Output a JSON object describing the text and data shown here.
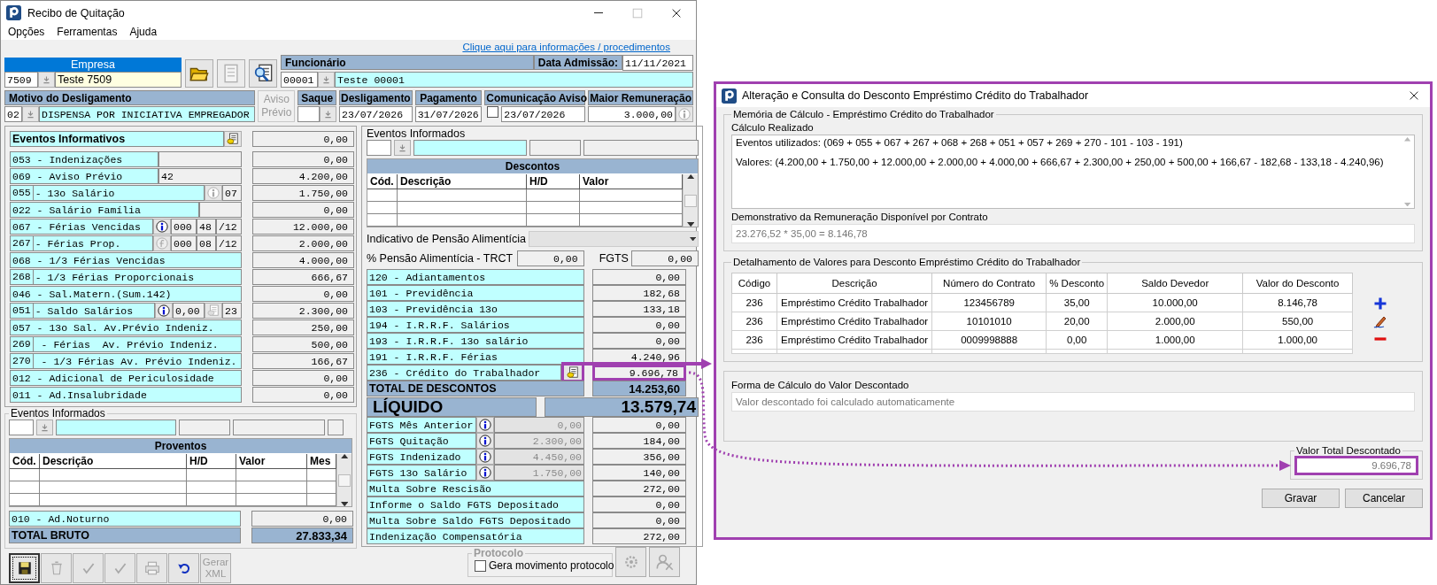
{
  "window": {
    "title": "Recibo de Quitação",
    "menu": [
      "Opções",
      "Ferramentas",
      "Ajuda"
    ],
    "help_link": "Clique aqui para informações / procedimentos"
  },
  "empresa": {
    "label": "Empresa",
    "code": "7509",
    "name": "Teste 7509"
  },
  "empresa_tools": [
    {
      "kind": "folder",
      "enabled": true
    },
    {
      "kind": "document",
      "enabled": false
    },
    {
      "kind": "search",
      "enabled": true
    }
  ],
  "funcionario": {
    "label": "Funcionário",
    "code": "00001",
    "name": "Teste 00001",
    "admission_label": "Data Admissão:",
    "admission_date": "11/11/2021"
  },
  "motivo": {
    "label": "Motivo do Desligamento",
    "code": "02",
    "description": "DISPENSA POR INICIATIVA EMPREGADOR"
  },
  "aviso_previo": {
    "label": "Aviso Prévio",
    "enabled": false
  },
  "dates": [
    {
      "kind": "dropdown",
      "label": "Saque"
    },
    {
      "kind": "date",
      "label": "Desligamento",
      "value": "23/07/2026"
    },
    {
      "kind": "date",
      "label": "Pagamento",
      "value": "31/07/2026"
    },
    {
      "kind": "checkdate",
      "label": "Comunicação Aviso",
      "checked": false,
      "value": "23/07/2026"
    },
    {
      "kind": "amount",
      "label": "Maior Remuneração",
      "value": "3.000,00"
    }
  ],
  "eventos_informativos": {
    "label": "Eventos Informativos",
    "value": "0,00"
  },
  "proventos_items": [
    {
      "kind": "wide_field",
      "split": false,
      "label": "053 - Indenizações",
      "value": "0,00"
    },
    {
      "kind": "wide_field",
      "split": false,
      "label": "069 - Aviso Prévio",
      "note": "42",
      "value": "4.200,00"
    },
    {
      "kind": "icon_fields",
      "split": true,
      "code": "055",
      "label": "- 13o Salário",
      "fields": [
        {
          "kind": "info",
          "enabled": false
        },
        {
          "kind": "text",
          "text": "07"
        }
      ],
      "value": "1.750,00"
    },
    {
      "kind": "narrow_field",
      "split": false,
      "label": "022 - Salário Família",
      "value": "0,00"
    },
    {
      "kind": "icon_fields",
      "split": false,
      "label": "067 - Férias Vencidas",
      "fields": [
        {
          "kind": "info",
          "enabled": true
        },
        {
          "kind": "text",
          "text": "000"
        },
        {
          "kind": "text",
          "text": "48"
        },
        {
          "kind": "text",
          "text": "/12"
        }
      ],
      "value": "12.000,00"
    },
    {
      "kind": "icon_fields",
      "split": true,
      "code": "267",
      "label": "- Férias Prop.",
      "fields": [
        {
          "kind": "formula",
          "enabled": false
        },
        {
          "kind": "text",
          "text": "000"
        },
        {
          "kind": "text",
          "text": "08"
        },
        {
          "kind": "text",
          "text": "/12"
        }
      ],
      "value": "2.000,00"
    },
    {
      "kind": "full",
      "split": false,
      "label": "068 - 1/3 Férias Vencidas",
      "value": "4.000,00"
    },
    {
      "kind": "full",
      "split": true,
      "code": "268",
      "label": "- 1/3 Férias Proporcionais",
      "value": "666,67"
    },
    {
      "kind": "full",
      "split": false,
      "label": "046 - Sal.Matern.(Sum.142)",
      "value": "0,00"
    },
    {
      "kind": "icon_fields",
      "split": true,
      "code": "051",
      "label": "- Saldo Salários",
      "fields": [
        {
          "kind": "info",
          "enabled": true
        },
        {
          "kind": "text",
          "text": "0,00"
        },
        {
          "kind": "doc",
          "enabled": false
        },
        {
          "kind": "text",
          "text": "23"
        }
      ],
      "value": "2.300,00"
    },
    {
      "kind": "full",
      "split": false,
      "label": "057 - 13o Sal. Av.Prévio Indeniz.",
      "value": "250,00"
    },
    {
      "kind": "full",
      "split": true,
      "code": "269",
      "label": " - Férias  Av. Prévio Indeniz.",
      "value": "500,00"
    },
    {
      "kind": "full",
      "split": true,
      "code": "270",
      "label": " - 1/3 Férias Av. Prévio Indeniz.",
      "value": "166,67"
    },
    {
      "kind": "full",
      "split": false,
      "label": "012 - Adicional de Periculosidade",
      "value": "0,00"
    },
    {
      "kind": "full",
      "split": false,
      "label": "011 - Ad.Insalubridade",
      "value": "0,00"
    }
  ],
  "eventos_informados_left": {
    "label": "Eventos Informados"
  },
  "proventos_table": {
    "title": "Proventos",
    "columns": [
      "Cód.",
      "Descrição",
      "H/D",
      "Valor",
      "Mes"
    ]
  },
  "ad_noturno": {
    "label": "010 - Ad.Noturno",
    "value": "0,00"
  },
  "total_bruto": {
    "label": "TOTAL BRUTO",
    "value": "27.833,34"
  },
  "toolbar": [
    {
      "kind": "save",
      "enabled": true
    },
    {
      "kind": "delete",
      "enabled": false
    },
    {
      "kind": "check",
      "enabled": false
    },
    {
      "kind": "check",
      "enabled": false
    },
    {
      "kind": "print",
      "enabled": false
    },
    {
      "kind": "undo",
      "enabled": true
    },
    {
      "kind": "text",
      "label": "Gerar XML",
      "enabled": false
    }
  ],
  "eventos_informados_right": {
    "label": "Eventos Informados"
  },
  "descontos_table": {
    "title": "Descontos",
    "columns": [
      "Cód.",
      "Descrição",
      "H/D",
      "Valor"
    ]
  },
  "pensao": {
    "indicativo_label": "Indicativo de Pensão Alimentícia",
    "percent_label": "% Pensão Alimentícia - TRCT",
    "percent_value": "0,00",
    "fgts_label": "FGTS",
    "fgts_value": "0,00"
  },
  "descontos_items": [
    {
      "label": "120 - Adiantamentos",
      "value": "0,00",
      "action": false,
      "highlighted": false
    },
    {
      "label": "101 - Previdência",
      "value": "182,68",
      "action": false,
      "highlighted": false
    },
    {
      "label": "103 - Previdência 13o",
      "value": "133,18",
      "action": false,
      "highlighted": false
    },
    {
      "label": "194 - I.R.R.F. Salários",
      "value": "0,00",
      "action": false,
      "highlighted": false
    },
    {
      "label": "193 - I.R.R.F. 13o salário",
      "value": "0,00",
      "action": false,
      "highlighted": false
    },
    {
      "label": "191 - I.R.R.F. Férias",
      "value": "4.240,96",
      "action": false,
      "highlighted": false
    },
    {
      "label": "236 - Crédito do Trabalhador",
      "value": "9.696,78",
      "action": true,
      "highlighted": true
    }
  ],
  "total_descontos": {
    "label": "TOTAL DE DESCONTOS",
    "value": "14.253,60"
  },
  "liquido": {
    "label": "LÍQUIDO",
    "value": "13.579,74"
  },
  "fgts_items": [
    {
      "label": "FGTS Mês Anterior",
      "base": "0,00",
      "value": "0,00"
    },
    {
      "label": "FGTS Quitação",
      "base": "2.300,00",
      "value": "184,00"
    },
    {
      "label": "FGTS Indenizado",
      "base": "4.450,00",
      "value": "356,00"
    },
    {
      "label": "FGTS 13o Salário",
      "base": "1.750,00",
      "value": "140,00"
    }
  ],
  "other_items": [
    {
      "label": "Multa Sobre Rescisão",
      "value": "272,00"
    },
    {
      "label": "Informe o Saldo FGTS Depositado",
      "value": "0,00"
    },
    {
      "label": "Multa Sobre Saldo FGTS Depositado",
      "value": "0,00"
    },
    {
      "label": "Indenização Compensatória",
      "value": "272,00"
    }
  ],
  "protocolo": {
    "legend": "Protocolo",
    "checkbox_label": "Gera movimento protocolo",
    "checked": false
  },
  "dialog": {
    "title": "Alteração e Consulta do Desconto Empréstimo Crédito do Trabalhador",
    "highlighted": true,
    "memoria": {
      "legend": "Memória de Cálculo - Empréstimo Crédito do Trabalhador",
      "calc_label": "Cálculo Realizado",
      "calc_lines": [
        "Eventos utilizados: (069 + 055 + 067 + 267 + 068 + 268 + 051 + 057 + 269 + 270 - 101 - 103 - 191)",
        "Valores: (4.200,00 + 1.750,00 + 12.000,00 + 2.000,00 + 4.000,00 + 666,67 + 2.300,00 + 250,00 + 500,00 + 166,67 - 182,68 - 133,18 - 4.240,96)"
      ],
      "demo_label": "Demonstrativo da Remuneração Disponível por Contrato",
      "demo_value": "23.276,52 * 35,00 = 8.146,78"
    },
    "detalhamento": {
      "legend": "Detalhamento de Valores para Desconto Empréstimo Crédito do Trabalhador",
      "columns": [
        "Código",
        "Descrição",
        "Número do Contrato",
        "% Desconto",
        "Saldo Devedor",
        "Valor do Desconto"
      ],
      "rows": [
        [
          "236",
          "Empréstimo Crédito Trabalhador",
          "123456789",
          "35,00",
          "10.000,00",
          "8.146,78"
        ],
        [
          "236",
          "Empréstimo Crédito Trabalhador",
          "10101010",
          "20,00",
          "2.000,00",
          "550,00"
        ],
        [
          "236",
          "Empréstimo Crédito Trabalhador",
          "0009998888",
          "0,00",
          "1.000,00",
          "1.000,00"
        ]
      ]
    },
    "forma": {
      "legend": "Forma de Cálculo do Valor Descontado",
      "value": "Valor descontado foi calculado automaticamente"
    },
    "valor_total": {
      "legend": "Valor Total Descontado",
      "value": "9.696,78",
      "highlighted": true
    },
    "buttons": [
      "Gravar",
      "Cancelar"
    ]
  }
}
